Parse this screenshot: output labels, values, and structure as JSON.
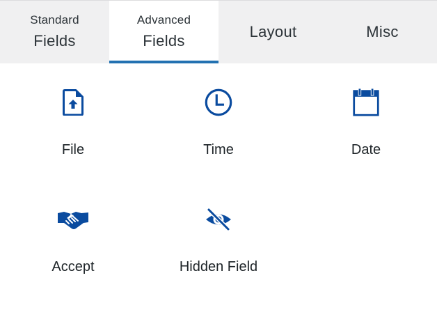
{
  "tabs": [
    {
      "line1": "Standard",
      "line2": "Fields",
      "active": false
    },
    {
      "line1": "Advanced",
      "line2": "Fields",
      "active": true
    },
    {
      "label": "Layout",
      "active": false
    },
    {
      "label": "Misc",
      "active": false
    }
  ],
  "fields": [
    {
      "label": "File",
      "icon": "file-upload-icon"
    },
    {
      "label": "Time",
      "icon": "clock-icon"
    },
    {
      "label": "Date",
      "icon": "calendar-icon"
    },
    {
      "label": "Accept",
      "icon": "handshake-icon"
    },
    {
      "label": "Hidden Field",
      "icon": "eye-slash-icon"
    }
  ],
  "colors": {
    "accent": "#2271b1",
    "icon": "#0a4b9f",
    "tab_bar_bg": "#f0f0f1",
    "text": "#1d2327"
  }
}
